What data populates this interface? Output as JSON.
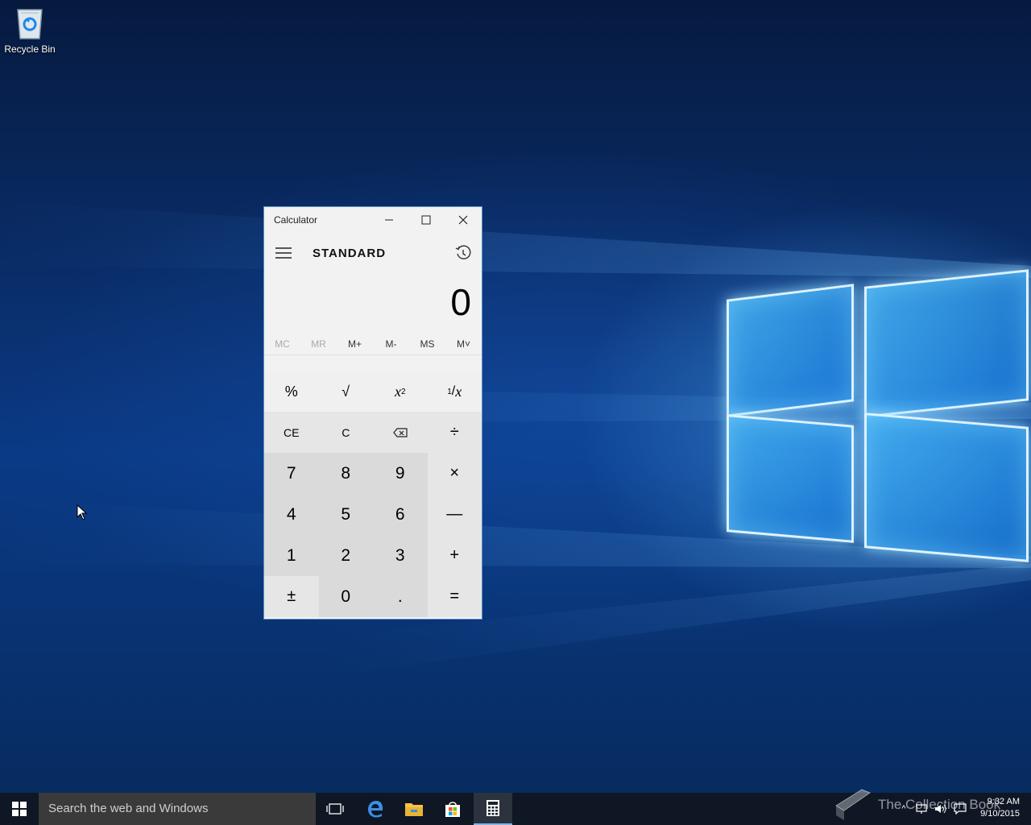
{
  "desktop": {
    "icons": [
      {
        "label": "Recycle Bin",
        "icon": "recycle-bin-icon"
      }
    ]
  },
  "calculator": {
    "title": "Calculator",
    "mode": "STANDARD",
    "display_value": "0",
    "memory": [
      {
        "label": "MC",
        "enabled": false
      },
      {
        "label": "MR",
        "enabled": false
      },
      {
        "label": "M+",
        "enabled": true
      },
      {
        "label": "M-",
        "enabled": true
      },
      {
        "label": "MS",
        "enabled": true
      },
      {
        "label": "M˅",
        "enabled": true
      }
    ],
    "keys": {
      "percent": "%",
      "sqrt": "√",
      "square_base": "x",
      "square_exp": "2",
      "recip_num": "1",
      "recip_den": "x",
      "ce": "CE",
      "c": "C",
      "divide": "÷",
      "seven": "7",
      "eight": "8",
      "nine": "9",
      "multiply": "×",
      "four": "4",
      "five": "5",
      "six": "6",
      "minus": "—",
      "one": "1",
      "two": "2",
      "three": "3",
      "plus": "+",
      "negate": "±",
      "zero": "0",
      "decimal": ".",
      "equals": "="
    }
  },
  "taskbar": {
    "search_placeholder": "Search the web and Windows",
    "apps": [
      "task-view-icon",
      "edge-icon",
      "file-explorer-icon",
      "store-icon",
      "calculator-icon"
    ],
    "time": "9:32 AM",
    "date": "9/10/2015",
    "watermark": "The Collection Book"
  },
  "colors": {
    "accent": "#7fb4e8",
    "window_border": "#5a8fc8"
  }
}
